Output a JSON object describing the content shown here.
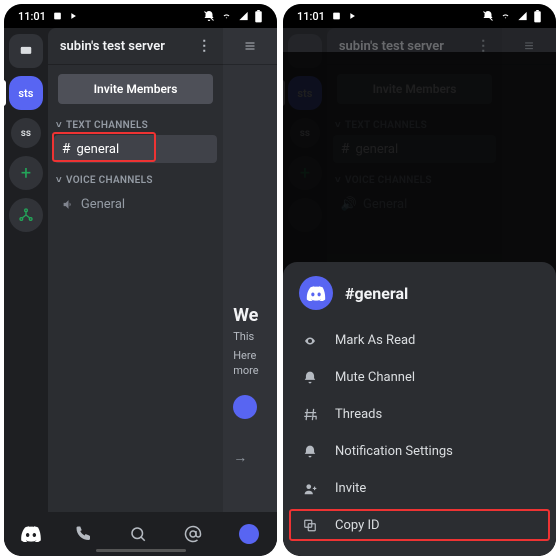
{
  "status": {
    "time": "11:01"
  },
  "server": {
    "name": "subin's test server",
    "invite_label": "Invite Members",
    "text_cat": "TEXT CHANNELS",
    "voice_cat": "VOICE CHANNELS",
    "text_channel": "general",
    "voice_channel": "General"
  },
  "rail": {
    "sel_label": "sts",
    "other_label": "ss",
    "add_label": "+"
  },
  "peek": {
    "welcome": "We",
    "sub1": "This",
    "sub2": "Here",
    "sub3": "more",
    "arrow": "→"
  },
  "sheet": {
    "title": "#general",
    "items": [
      "Mark As Read",
      "Mute Channel",
      "Threads",
      "Notification Settings",
      "Invite",
      "Copy ID"
    ]
  }
}
